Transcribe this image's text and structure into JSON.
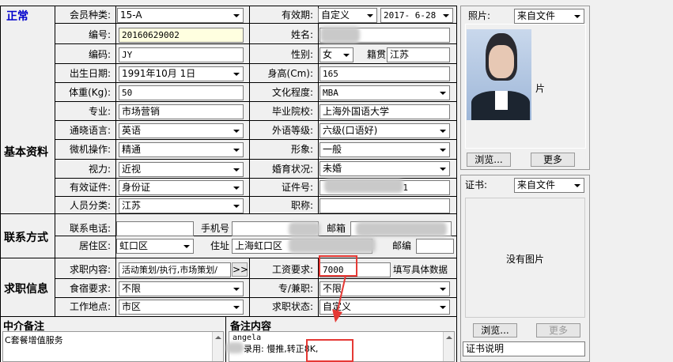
{
  "status": "正常",
  "sections": {
    "basic": "基本资料",
    "contact": "联系方式",
    "job": "求职信息",
    "agency_note": "中介备注",
    "remark": "备注内容"
  },
  "fields": {
    "member_type": {
      "label": "会员种类:",
      "value": "15-A"
    },
    "validity": {
      "label": "有效期:",
      "mode": "自定义",
      "date": "2017- 6-28"
    },
    "number": {
      "label": "编号:",
      "value": "20160629002"
    },
    "name": {
      "label": "姓名:",
      "value": ""
    },
    "code": {
      "label": "编码:",
      "value": "JY"
    },
    "gender": {
      "label": "性别:",
      "value": "女"
    },
    "native": {
      "label": "籍贯",
      "value": "江苏"
    },
    "birthdate": {
      "label": "出生日期:",
      "value": "1991年10月 1日"
    },
    "height": {
      "label": "身高(Cm):",
      "value": "165"
    },
    "weight": {
      "label": "体重(Kg):",
      "value": "50"
    },
    "education": {
      "label": "文化程度:",
      "value": "MBA"
    },
    "major": {
      "label": "专业:",
      "value": "市场营销"
    },
    "school": {
      "label": "毕业院校:",
      "value": "上海外国语大学"
    },
    "language": {
      "label": "通晓语言:",
      "value": "英语"
    },
    "foreign_level": {
      "label": "外语等级:",
      "value": "六级(口语好)"
    },
    "computer": {
      "label": "微机操作:",
      "value": "精通"
    },
    "appearance": {
      "label": "形象:",
      "value": "一般"
    },
    "eyesight": {
      "label": "视力:",
      "value": "近视"
    },
    "marital": {
      "label": "婚育状况:",
      "value": "未婚"
    },
    "id_type": {
      "label": "有效证件:",
      "value": "身份证"
    },
    "id_number": {
      "label": "证件号:",
      "value": "1"
    },
    "category": {
      "label": "人员分类:",
      "value": "江苏"
    },
    "title": {
      "label": "职称:",
      "value": ""
    },
    "phone": {
      "label": "联系电话:",
      "value": ""
    },
    "mobile": {
      "label": "手机号",
      "value": ""
    },
    "email": {
      "label": "邮箱",
      "value": ""
    },
    "district": {
      "label": "居住区:",
      "value": "虹口区"
    },
    "address": {
      "label": "住址",
      "value": "上海虹口区"
    },
    "postcode": {
      "label": "邮编",
      "value": ""
    },
    "job_content": {
      "label": "求职内容:",
      "value": "活动策划/执行,市场策划/",
      "more": ">>"
    },
    "salary": {
      "label": "工资要求:",
      "value": "7000",
      "hint": "填写具体数据"
    },
    "board": {
      "label": "食宿要求:",
      "value": "不限"
    },
    "fulltime": {
      "label": "专/兼职:",
      "value": "不限"
    },
    "location": {
      "label": "工作地点:",
      "value": "市区"
    },
    "job_status": {
      "label": "求职状态:",
      "value": "自定义"
    }
  },
  "agency_note_text": "C套餐增值服务",
  "remark_text": {
    "line1": "angela",
    "line2_prefix": "录用: 慢推,",
    "line2_hl": "转正8K,"
  },
  "photo": {
    "label": "照片:",
    "source": "来自文件",
    "overlay": "片",
    "browse": "浏览...",
    "more": "更多"
  },
  "cert": {
    "label": "证书:",
    "source": "来自文件",
    "empty": "没有图片",
    "browse": "浏览...",
    "more": "更多",
    "desc": "证书说明"
  },
  "colors": {
    "accent_blue": "#0000cc",
    "highlight_red": "#e53935"
  }
}
